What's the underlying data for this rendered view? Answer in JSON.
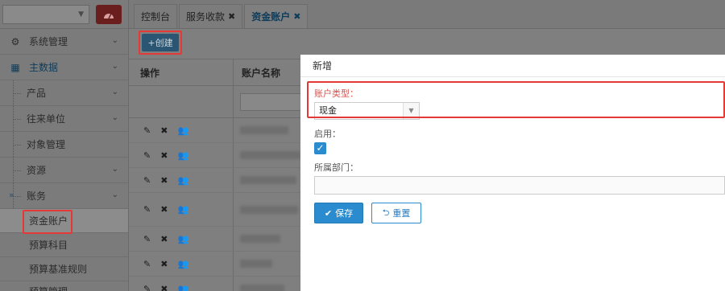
{
  "sidebar": {
    "select_caret": "▼",
    "top_button_icon": "dashboard-icon",
    "items": [
      {
        "label": "系统管理",
        "icon": "gears-icon",
        "chevron": "chevron-down"
      },
      {
        "label": "主数据",
        "icon": "grid-icon",
        "chevron": "chevron-down"
      },
      {
        "label": "产品",
        "chevron": "chevron-down"
      },
      {
        "label": "往来单位",
        "chevron": "chevron-down"
      },
      {
        "label": "对象管理"
      },
      {
        "label": "资源",
        "chevron": "chevron-down"
      },
      {
        "label": "账务",
        "chevron": "chevron-down"
      }
    ],
    "children": [
      {
        "label": "资金账户",
        "active": true
      },
      {
        "label": "预算科目"
      },
      {
        "label": "预算基准规则"
      },
      {
        "label": "预算管理"
      }
    ]
  },
  "tabs": [
    {
      "label": "控制台",
      "closable": false
    },
    {
      "label": "服务收款",
      "closable": true
    },
    {
      "label": "资金账户",
      "closable": true,
      "active": true
    }
  ],
  "toolbar": {
    "create_label": "+创建"
  },
  "table": {
    "columns": [
      "操作",
      "账户名称"
    ],
    "row_count": 7
  },
  "modal": {
    "title": "新增",
    "account_type_label": "账户类型：",
    "account_type_value": "现金",
    "enabled_label": "启用：",
    "enabled_checked": true,
    "department_label": "所属部门：",
    "department_value": "",
    "save_label": "保存",
    "reset_label": "重置"
  },
  "colors": {
    "primary": "#2a8bcf",
    "highlight": "#e53935",
    "overlay_gray": "#7f7f7f"
  }
}
